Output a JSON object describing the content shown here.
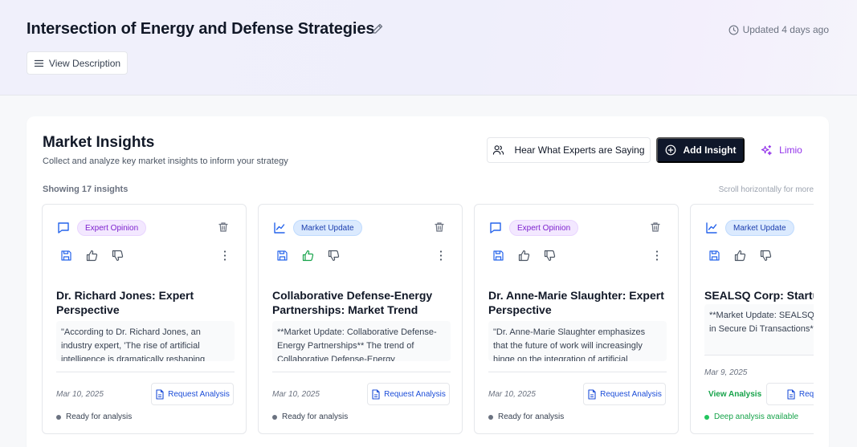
{
  "header": {
    "title": "Intersection of Energy and Defense Strategies",
    "updated": "Updated 4 days ago",
    "view_description": "View Description"
  },
  "section": {
    "title": "Market Insights",
    "subtitle": "Collect and analyze key market insights to inform your strategy",
    "experts_button": "Hear What Experts are Saying",
    "add_button": "Add Insight",
    "limio_button": "Limio",
    "showing": "Showing 17 insights",
    "scroll_hint": "Scroll horizontally for more"
  },
  "colors": {
    "accent_dark": "#0f172a",
    "limio_purple": "#9333ea",
    "opinion_badge": "#f3e8ff",
    "update_badge": "#dbeafe",
    "link_blue": "#1d4ed8",
    "success_green": "#16a34a"
  },
  "cards": [
    {
      "type_icon": "message-icon",
      "badge": "Expert Opinion",
      "title": "Dr. Richard Jones: Expert Perspective",
      "excerpt": "\"According to Dr. Richard Jones, an industry expert, 'The rise of artificial intelligence is dramatically reshaping",
      "date": "Mar 10, 2025",
      "request": "Request Analysis",
      "status": "Ready for analysis",
      "liked": false
    },
    {
      "type_icon": "chart-line-icon",
      "badge": "Market Update",
      "title": "Collaborative Defense-Energy Partnerships: Market Trend",
      "excerpt": "**Market Update: Collaborative Defense-Energy Partnerships** The trend of Collaborative Defense-Energy",
      "date": "Mar 10, 2025",
      "request": "Request Analysis",
      "status": "Ready for analysis",
      "liked": true
    },
    {
      "type_icon": "message-icon",
      "badge": "Expert Opinion",
      "title": "Dr. Anne-Marie Slaughter: Expert Perspective",
      "excerpt": "\"Dr. Anne-Marie Slaughter emphasizes that the future of work will increasingly hinge on the integration of artificial",
      "date": "Mar 10, 2025",
      "request": "Request Analysis",
      "status": "Ready for analysis",
      "liked": false
    },
    {
      "type_icon": "chart-line-icon",
      "badge": "Market Update",
      "title": "SEALSQ Corp: Startup",
      "excerpt": "**Market Update: SEALSQ as a Disruptor in Secure Di Transactions** SEALSQ C",
      "date": "Mar 9, 2025",
      "view_analysis": "View Analysis",
      "request": "Request",
      "status": "Deep analysis available",
      "liked": false
    }
  ]
}
